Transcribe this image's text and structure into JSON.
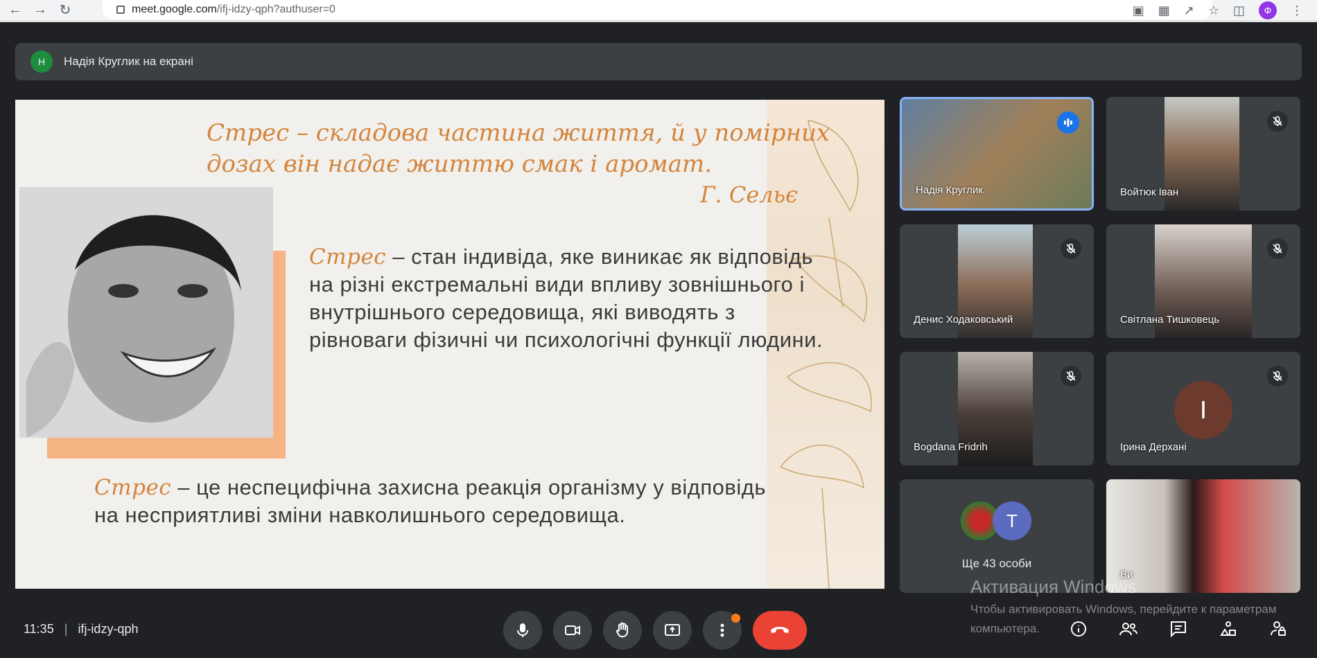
{
  "browser": {
    "url_host": "meet.google.com",
    "url_path": "/ifj-idzy-qph?authuser=0",
    "profile_initial": "Ф"
  },
  "presenter": {
    "initial": "Н",
    "text": "Надія Круглик на екрані"
  },
  "slide": {
    "quote_line1": "Стрес – складова частина життя, й у помірних",
    "quote_line2": "дозах він надає життю смак і аромат.",
    "author": "Г. Сельє",
    "def1_kw": "Стрес",
    "def1_text": " – стан індивіда, яке виникає як відповідь на різні екстремальні види впливу зовнішнього і внутрішнього середовища, які виводять з рівноваги фізичні чи психологічні функції людини.",
    "def2_kw": "Стрес",
    "def2_text": " – це неспецифічна захисна реакція організму у відповідь на несприятливі зміни навколишнього середовища.",
    "colors": {
      "accent": "#d4843c",
      "block": "#f6b384"
    }
  },
  "participants": [
    {
      "name": "Надія Круглик",
      "state": "speaking"
    },
    {
      "name": "Войтюк Іван",
      "state": "muted"
    },
    {
      "name": "Денис Ходаковський",
      "state": "muted"
    },
    {
      "name": "Світлана Тишковець",
      "state": "muted"
    },
    {
      "name": "Bogdana Fridrih",
      "state": "muted"
    },
    {
      "name": "Ірина Дерхані",
      "state": "muted",
      "initial": "I"
    }
  ],
  "more": {
    "avatar_initial": "T",
    "label": "Ще 43 особи"
  },
  "self_tile": {
    "name": "Ви"
  },
  "watermark": {
    "title": "Активация Windows",
    "sub": "Чтобы активировать Windows, перейдите к параметрам компьютера."
  },
  "bottom": {
    "time": "11:35",
    "separator": "|",
    "meeting_code": "ifj-idzy-qph"
  }
}
